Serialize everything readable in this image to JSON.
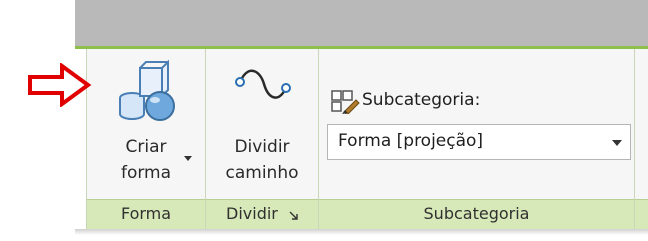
{
  "ribbon": {
    "create_form": {
      "line1": "Criar",
      "line2": "forma"
    },
    "divide_path": {
      "line1": "Dividir",
      "line2": "caminho"
    },
    "subcategory": {
      "label": "Subcategoria:",
      "selected": "Forma [projeção]"
    },
    "panels": {
      "forma": "Forma",
      "dividir": "Dividir",
      "subcategoria": "Subcategoria"
    }
  },
  "colors": {
    "accent_green": "#8cc04a",
    "label_strip": "#d7e9b8",
    "arrow_red": "#e00000",
    "icon_blue": "#6fa8dc"
  },
  "icons": {
    "create_form": "create-form-icon",
    "divide_path": "divide-path-icon",
    "subcategory": "subcategory-icon",
    "dialog_launcher": "dialog-launcher-icon",
    "annotation_arrow": "red-arrow-icon"
  }
}
